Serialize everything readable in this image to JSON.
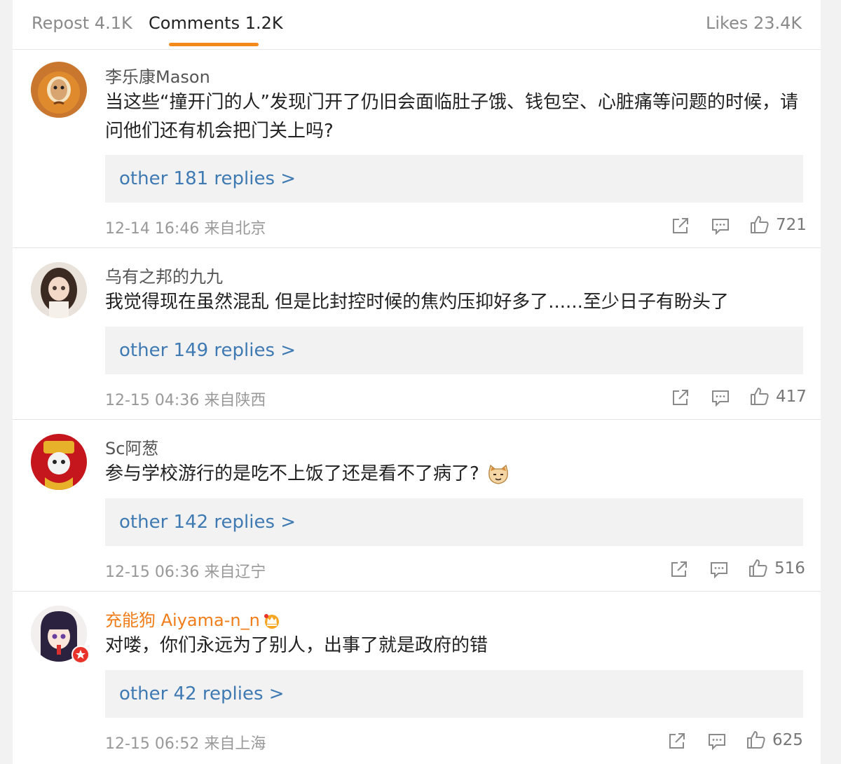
{
  "tabs": [
    {
      "label": "Repost 4.1K"
    },
    {
      "label": "Comments 1.2K"
    },
    {
      "label": "Likes 23.4K"
    }
  ],
  "comments": [
    {
      "user": "李乐康Mason",
      "text": "当这些“撞开门的人”发现门开了仍旧会面临肚子饿、钱包空、心脏痛等问题的时候，请问他们还有机会把门关上吗?",
      "replies": "other 181 replies >",
      "meta": "12-14 16:46 来自北京",
      "likes": "721"
    },
    {
      "user": "乌有之邦的九九",
      "text": "我觉得现在虽然混乱 但是比封控时候的焦灼压抑好多了......至少日子有盼头了",
      "replies": "other 149 replies >",
      "meta": "12-15 04:36 来自陕西",
      "likes": "417"
    },
    {
      "user": "Sc阿葱",
      "text": "参与学校游行的是吃不上饭了还是看不了病了?",
      "replies": "other 142 replies >",
      "meta": "12-15 06:36 来自辽宁",
      "likes": "516"
    },
    {
      "user": "充能狗 Aiyama-n_n",
      "text": "对喽，你们永远为了别人，出事了就是政府的错",
      "replies": "other 42 replies >",
      "meta": "12-15 06:52 来自上海",
      "likes": "625"
    }
  ],
  "icons": {
    "share": "share-icon",
    "comment": "comment-icon",
    "like": "thumbs-up-icon",
    "crown": "crown-icon",
    "emoji": "cat-emoji-icon"
  },
  "colors": {
    "accent": "#f48a1c",
    "link": "#3f7ab3",
    "vip_name": "#f07d1a"
  }
}
